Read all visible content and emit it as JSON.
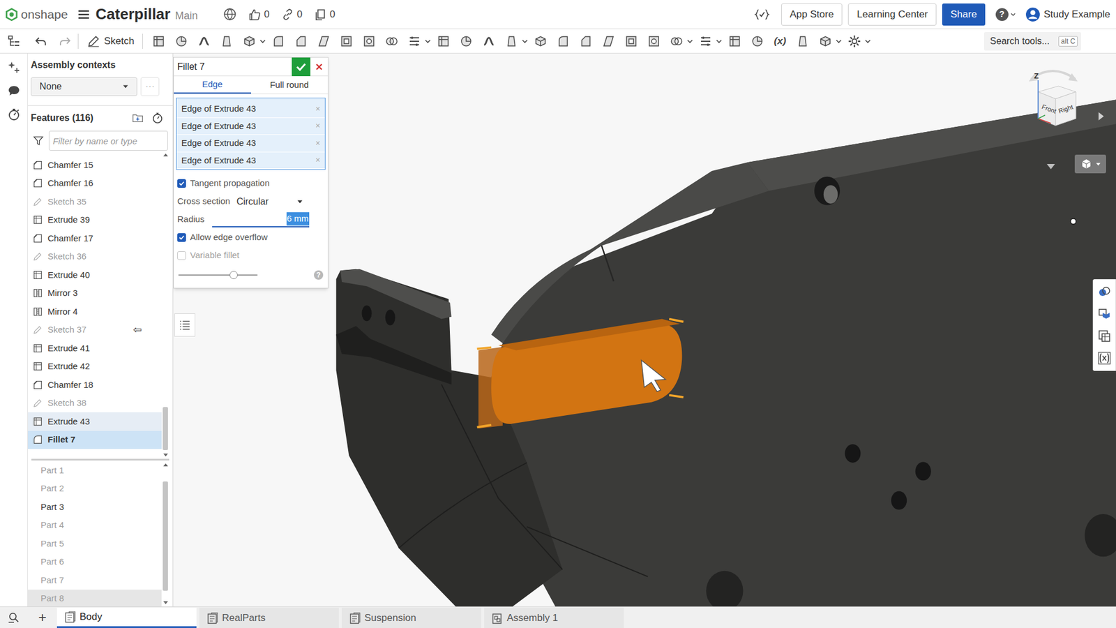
{
  "document": {
    "app": "onshape",
    "title": "Caterpillar",
    "branch": "Main",
    "stats": [
      {
        "kind": "likes",
        "count": "0"
      },
      {
        "kind": "links",
        "count": "0"
      },
      {
        "kind": "copies",
        "count": "0"
      }
    ]
  },
  "header": {
    "buttons": [
      {
        "label": "App Store",
        "primary": false
      },
      {
        "label": "Learning Center",
        "primary": false
      },
      {
        "label": "Share",
        "primary": true
      }
    ],
    "help": "?",
    "user": "Study Example"
  },
  "toolbar": {
    "sketch": "Sketch",
    "variables": "(x)",
    "search": {
      "placeholder": "Search tools...",
      "shortcut": "alt C"
    }
  },
  "left_panel": {
    "assembly_contexts": {
      "label": "Assembly contexts",
      "value": "None",
      "more": "···"
    },
    "features": {
      "label": "Features (116)",
      "filter_placeholder": "Filter by name or type",
      "items": [
        {
          "name": "Chamfer 15",
          "kind": "chamfer",
          "selected": false,
          "highlighted": false
        },
        {
          "name": "Chamfer 16",
          "kind": "chamfer",
          "selected": false,
          "highlighted": false
        },
        {
          "name": "Sketch 35",
          "kind": "sketch",
          "selected": false,
          "highlighted": false
        },
        {
          "name": "Extrude 39",
          "kind": "extrude",
          "selected": false,
          "highlighted": false
        },
        {
          "name": "Chamfer 17",
          "kind": "chamfer",
          "selected": false,
          "highlighted": false
        },
        {
          "name": "Sketch 36",
          "kind": "sketch",
          "selected": false,
          "highlighted": false
        },
        {
          "name": "Extrude 40",
          "kind": "extrude",
          "selected": false,
          "highlighted": false
        },
        {
          "name": "Mirror 3",
          "kind": "mirror",
          "selected": false,
          "highlighted": false
        },
        {
          "name": "Mirror 4",
          "kind": "mirror",
          "selected": false,
          "highlighted": false
        },
        {
          "name": "Sketch 37",
          "kind": "sketch",
          "selected": false,
          "highlighted": false,
          "marker": "⇦"
        },
        {
          "name": "Extrude 41",
          "kind": "extrude",
          "selected": false,
          "highlighted": false
        },
        {
          "name": "Extrude 42",
          "kind": "extrude",
          "selected": false,
          "highlighted": false
        },
        {
          "name": "Chamfer 18",
          "kind": "chamfer",
          "selected": false,
          "highlighted": false
        },
        {
          "name": "Sketch 38",
          "kind": "sketch",
          "selected": false,
          "highlighted": false
        },
        {
          "name": "Extrude 43",
          "kind": "extrude",
          "selected": false,
          "highlighted": true
        },
        {
          "name": "Fillet 7",
          "kind": "fillet",
          "selected": true,
          "highlighted": false
        }
      ]
    },
    "parts": [
      {
        "name": "Part 1",
        "hidden": true,
        "selected": false
      },
      {
        "name": "Part 2",
        "hidden": true,
        "selected": false
      },
      {
        "name": "Part 3",
        "hidden": false,
        "selected": false
      },
      {
        "name": "Part 4",
        "hidden": true,
        "selected": false
      },
      {
        "name": "Part 5",
        "hidden": true,
        "selected": false
      },
      {
        "name": "Part 6",
        "hidden": true,
        "selected": false
      },
      {
        "name": "Part 7",
        "hidden": true,
        "selected": false
      },
      {
        "name": "Part 8",
        "hidden": true,
        "selected": true
      }
    ]
  },
  "dialog": {
    "title": "Fillet 7",
    "tabs": [
      {
        "label": "Edge",
        "selected": true
      },
      {
        "label": "Full round",
        "selected": false
      }
    ],
    "selections": [
      {
        "label": "Edge of Extrude 43",
        "remove": "×"
      },
      {
        "label": "Edge of Extrude 43",
        "remove": "×"
      },
      {
        "label": "Edge of Extrude 43",
        "remove": "×"
      },
      {
        "label": "Edge of Extrude 43",
        "remove": "×"
      }
    ],
    "options": [
      {
        "kind": "checkbox",
        "label": "Tangent propagation",
        "checked": true,
        "disabled": false
      },
      {
        "kind": "select",
        "label": "Cross section",
        "value": "Circular"
      },
      {
        "kind": "input",
        "label": "Radius",
        "value": "6 mm"
      },
      {
        "kind": "checkbox",
        "label": "Allow edge overflow",
        "checked": true,
        "disabled": false
      },
      {
        "kind": "checkbox",
        "label": "Variable fillet",
        "checked": false,
        "disabled": true
      }
    ],
    "slider": {
      "level": 0.7
    },
    "help": "?"
  },
  "view_cube": {
    "axis": "Z",
    "faces": [
      "Front",
      "Right"
    ]
  },
  "bottom_bar": {
    "add": "+",
    "tabs": [
      {
        "label": "Body",
        "kind": "part_studio",
        "selected": true
      },
      {
        "label": "RealParts",
        "kind": "part_studio",
        "selected": false
      },
      {
        "label": "Suspension",
        "kind": "part_studio",
        "selected": false
      },
      {
        "label": "Assembly 1",
        "kind": "assembly",
        "selected": false
      }
    ]
  }
}
